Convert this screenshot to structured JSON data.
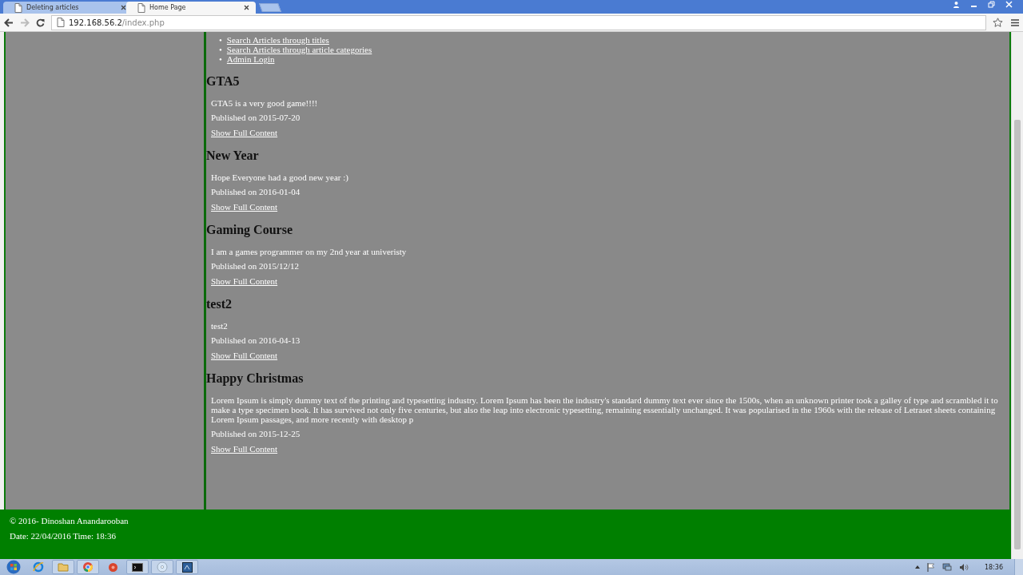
{
  "browser": {
    "tabs": [
      {
        "title": "Deleting articles",
        "selected": false
      },
      {
        "title": "Home Page",
        "selected": true
      }
    ],
    "address": {
      "host": "192.168.56.2",
      "path": "/index.php"
    }
  },
  "nav_links": [
    {
      "bullet": "•",
      "label": "Search Articles through titles"
    },
    {
      "bullet": "•",
      "label": "Search Articles through article categories"
    },
    {
      "bullet": "•",
      "label": "Admin Login"
    }
  ],
  "articles": [
    {
      "title": "GTA5",
      "body": "GTA5 is a very good game!!!!",
      "published": "Published on 2015-07-20",
      "link": "Show Full Content"
    },
    {
      "title": "New Year",
      "body": "Hope Everyone had a good new year :)",
      "published": "Published on 2016-01-04",
      "link": "Show Full Content"
    },
    {
      "title": "Gaming Course",
      "body": "I am a games programmer on my 2nd year at univeristy",
      "published": "Published on 2015/12/12",
      "link": "Show Full Content"
    },
    {
      "title": "test2",
      "body": "test2",
      "published": "Published on 2016-04-13",
      "link": "Show Full Content"
    },
    {
      "title": "Happy Christmas",
      "body": "Lorem Ipsum is simply dummy text of the printing and typesetting industry. Lorem Ipsum has been the industry's standard dummy text ever since the 1500s, when an unknown printer took a galley of type and scrambled it to make a type specimen book. It has survived not only five centuries, but also the leap into electronic typesetting, remaining essentially unchanged. It was popularised in the 1960s with the release of Letraset sheets containing Lorem Ipsum passages, and more recently with desktop p",
      "published": "Published on 2015-12-25",
      "link": "Show Full Content"
    }
  ],
  "footer": {
    "copyright": "© 2016- Dinoshan Anandarooban",
    "datetime": "Date: 22/04/2016 Time: 18:36"
  },
  "taskbar": {
    "clock": "18:36"
  }
}
